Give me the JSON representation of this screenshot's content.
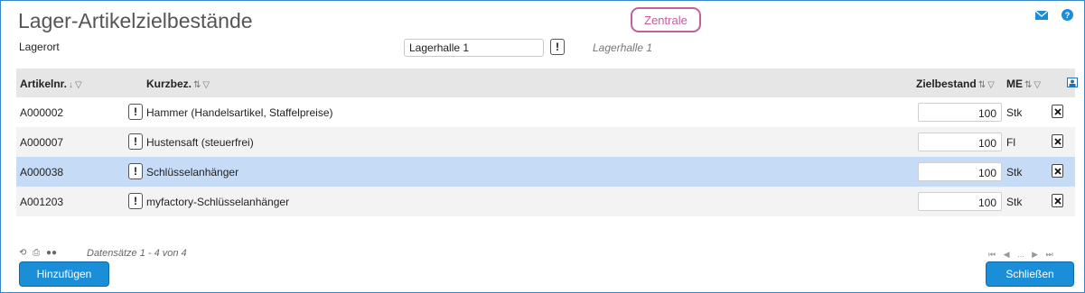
{
  "page": {
    "title": "Lager-Artikelzielbestände",
    "context_badge": "Zentrale"
  },
  "colors": {
    "accent": "#1b8ed8",
    "badge": "#c3609a",
    "selected_row": "#c6dbf6",
    "header_bg": "#e6e6e6"
  },
  "icons": {
    "mail": "mail-icon",
    "help": "help-icon",
    "info": "exclamation-icon",
    "delete": "delete-icon"
  },
  "filter": {
    "label": "Lagerort",
    "value": "Lagerhalle 1",
    "resolved": "Lagerhalle 1",
    "info_button": "!"
  },
  "table": {
    "columns": {
      "artikelnr": "Artikelnr.",
      "kurzbez": "Kurzbez.",
      "zielbestand": "Zielbestand",
      "me": "ME"
    },
    "rows": [
      {
        "artikelnr": "A000002",
        "kurzbez": "Hammer (Handelsartikel, Staffelpreise)",
        "zielbestand": "100",
        "me": "Stk",
        "selected": false
      },
      {
        "artikelnr": "A000007",
        "kurzbez": "Hustensaft (steuerfrei)",
        "zielbestand": "100",
        "me": "Fl",
        "selected": false
      },
      {
        "artikelnr": "A000038",
        "kurzbez": "Schlüsselanhänger",
        "zielbestand": "100",
        "me": "Stk",
        "selected": true
      },
      {
        "artikelnr": "A001203",
        "kurzbez": "myfactory-Schlüsselanhänger",
        "zielbestand": "100",
        "me": "Stk",
        "selected": false
      }
    ]
  },
  "footer": {
    "records": "Datensätze 1 - 4 von 4",
    "pager_ellipsis": "...",
    "add_button": "Hinzufügen",
    "close_button": "Schließen"
  }
}
